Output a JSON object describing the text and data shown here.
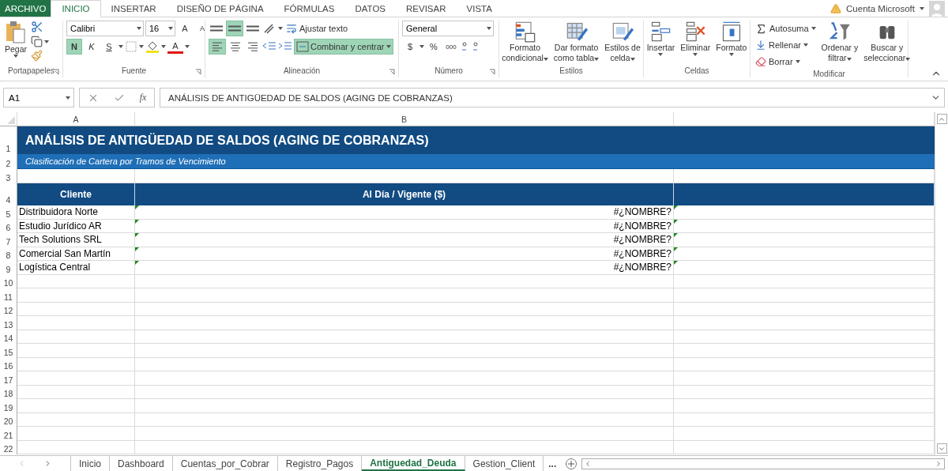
{
  "menu_tabs": [
    {
      "label": "ARCHIVO",
      "kind": "file",
      "selected": false
    },
    {
      "label": "INICIO",
      "kind": "tab",
      "selected": true
    },
    {
      "label": "INSERTAR",
      "kind": "tab",
      "selected": false
    },
    {
      "label": "DISEÑO DE PÁGINA",
      "kind": "tab",
      "selected": false
    },
    {
      "label": "FÓRMULAS",
      "kind": "tab",
      "selected": false
    },
    {
      "label": "DATOS",
      "kind": "tab",
      "selected": false
    },
    {
      "label": "REVISAR",
      "kind": "tab",
      "selected": false
    },
    {
      "label": "VISTA",
      "kind": "tab",
      "selected": false
    }
  ],
  "account": {
    "label": "Cuenta Microsoft",
    "warning": true
  },
  "ribbon": {
    "clipboard": {
      "label": "Portapapeles",
      "paste": "Pegar"
    },
    "font": {
      "label": "Fuente",
      "font_name": "Calibri",
      "font_size": "16",
      "grow": "A",
      "shrink": "A",
      "font_color": "A",
      "styles": [
        {
          "label": "N",
          "kind": "bold",
          "on": true
        },
        {
          "label": "K",
          "kind": "italic",
          "on": false
        },
        {
          "label": "S",
          "kind": "underline",
          "on": false
        }
      ]
    },
    "alignment": {
      "label": "Alineación",
      "wrap": "Ajustar texto",
      "merge": {
        "label": "Combinar y centrar",
        "on": true
      },
      "vertical": [
        {
          "selected": false
        },
        {
          "selected": true
        },
        {
          "selected": false
        }
      ],
      "horizontal": [
        {
          "selected": true
        },
        {
          "selected": false
        },
        {
          "selected": false
        }
      ]
    },
    "number": {
      "label": "Número",
      "format": "General",
      "currency": "$",
      "percent": "%",
      "thousands": "000"
    },
    "styles": {
      "label": "Estilos",
      "buttons": [
        {
          "lines": [
            "Formato",
            "condicional"
          ],
          "kind": "conditional"
        },
        {
          "lines": [
            "Dar formato",
            "como tabla"
          ],
          "kind": "table"
        },
        {
          "lines": [
            "Estilos de",
            "celda"
          ],
          "kind": "cellstyle"
        }
      ]
    },
    "cells": {
      "label": "Celdas",
      "buttons": [
        {
          "lines": [
            "Insertar"
          ],
          "kind": "insert"
        },
        {
          "lines": [
            "Eliminar"
          ],
          "kind": "delete"
        },
        {
          "lines": [
            "Formato"
          ],
          "kind": "format"
        }
      ]
    },
    "editing": {
      "label": "Modificar",
      "small": [
        {
          "label": "Autosuma",
          "kind": "sum"
        },
        {
          "label": "Rellenar",
          "kind": "fill"
        },
        {
          "label": "Borrar",
          "kind": "clear"
        }
      ],
      "buttons": [
        {
          "lines": [
            "Ordenar y",
            "filtrar"
          ],
          "kind": "sort"
        },
        {
          "lines": [
            "Buscar y",
            "seleccionar"
          ],
          "kind": "find"
        }
      ]
    }
  },
  "formula_bar": {
    "name_box": "A1",
    "fx": "fx",
    "formula": "ANÁLISIS DE ANTIGÜEDAD DE SALDOS (AGING DE COBRANZAS)"
  },
  "sheet": {
    "columns": [
      "A",
      "B"
    ],
    "rows": [
      {
        "number": "1",
        "kind": "title",
        "text": "ANÁLISIS DE ANTIGÜEDAD DE SALDOS (AGING DE COBRANZAS)"
      },
      {
        "number": "2",
        "kind": "subtitle",
        "text": "Clasificación de Cartera por Tramos de Vencimiento"
      },
      {
        "number": "3",
        "kind": "blank"
      },
      {
        "number": "4",
        "kind": "header",
        "cells": [
          "Cliente",
          "Al Día / Vigente ($)"
        ]
      },
      {
        "number": "5",
        "kind": "data",
        "cells": [
          "Distribuidora Norte",
          "#¿NOMBRE?"
        ],
        "warning": true
      },
      {
        "number": "6",
        "kind": "data",
        "cells": [
          "Estudio Jurídico AR",
          "#¿NOMBRE?"
        ],
        "warning": true
      },
      {
        "number": "7",
        "kind": "data",
        "cells": [
          "Tech Solutions SRL",
          "#¿NOMBRE?"
        ],
        "warning": true
      },
      {
        "number": "8",
        "kind": "data",
        "cells": [
          "Comercial San Martín",
          "#¿NOMBRE?"
        ],
        "warning": true
      },
      {
        "number": "9",
        "kind": "data",
        "cells": [
          "Logística Central",
          "#¿NOMBRE?"
        ],
        "warning": true
      },
      {
        "number": "10",
        "kind": "empty"
      },
      {
        "number": "11",
        "kind": "empty"
      },
      {
        "number": "12",
        "kind": "empty"
      },
      {
        "number": "13",
        "kind": "empty"
      },
      {
        "number": "14",
        "kind": "empty"
      },
      {
        "number": "15",
        "kind": "empty"
      },
      {
        "number": "16",
        "kind": "empty"
      },
      {
        "number": "17",
        "kind": "empty"
      },
      {
        "number": "18",
        "kind": "empty"
      },
      {
        "number": "19",
        "kind": "empty"
      },
      {
        "number": "20",
        "kind": "empty"
      },
      {
        "number": "21",
        "kind": "empty"
      },
      {
        "number": "22",
        "kind": "empty"
      }
    ]
  },
  "sheet_tabs": [
    {
      "label": "Inicio",
      "selected": false
    },
    {
      "label": "Dashboard",
      "selected": false
    },
    {
      "label": "Cuentas_por_Cobrar",
      "selected": false
    },
    {
      "label": "Registro_Pagos",
      "selected": false
    },
    {
      "label": "Antiguedad_Deuda",
      "selected": true
    },
    {
      "label": "Gestion_Client",
      "selected": false
    }
  ],
  "tabs_more": "..."
}
